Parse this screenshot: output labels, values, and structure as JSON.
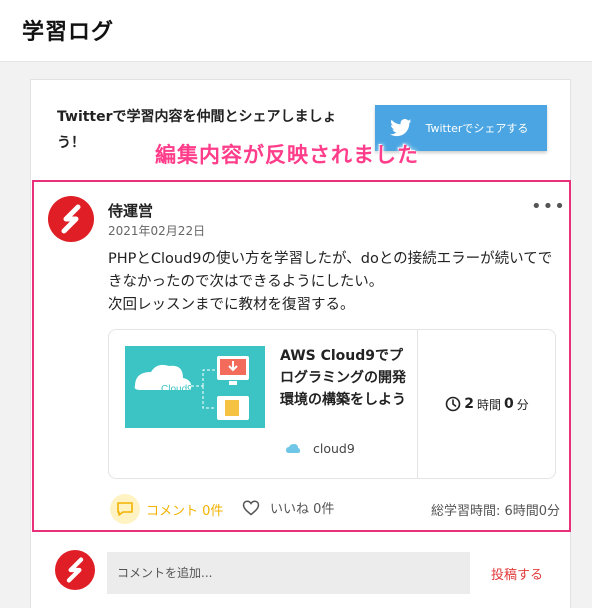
{
  "header": {
    "title": "学習ログ"
  },
  "share": {
    "text": "Twitterで学習内容を仲間とシェアしましょう！",
    "button_label": "Twitterでシェアする",
    "button_color": "#4aa5e2"
  },
  "banner": {
    "text": "編集内容が反映されました",
    "color": "#ff3d8a"
  },
  "post": {
    "user_name": "侍運営",
    "date": "2021年02月22日",
    "body_line1": "PHPとCloud9の使い方を学習したが、doとの接続エラーが続いてできなかったので次はできるようにしたい。",
    "body_line2": "次回レッスンまでに教材を復習する。",
    "more_icon": "ellipsis-icon",
    "card": {
      "title": "AWS Cloud9でプログラミングの開発環境の構築をしよう",
      "thumb_label": "Cloud9",
      "tag": "cloud9",
      "duration_hours": "2",
      "duration_hours_unit": "時間",
      "duration_minutes": "0",
      "duration_minutes_unit": "分"
    },
    "comment_label": "コメント 0件",
    "like_label": "いいね 0件",
    "total_time": "総学習時間: 6時間0分",
    "highlight_color": "#e8317a"
  },
  "comment_form": {
    "placeholder": "コメントを追加...",
    "submit_label": "投稿する"
  }
}
